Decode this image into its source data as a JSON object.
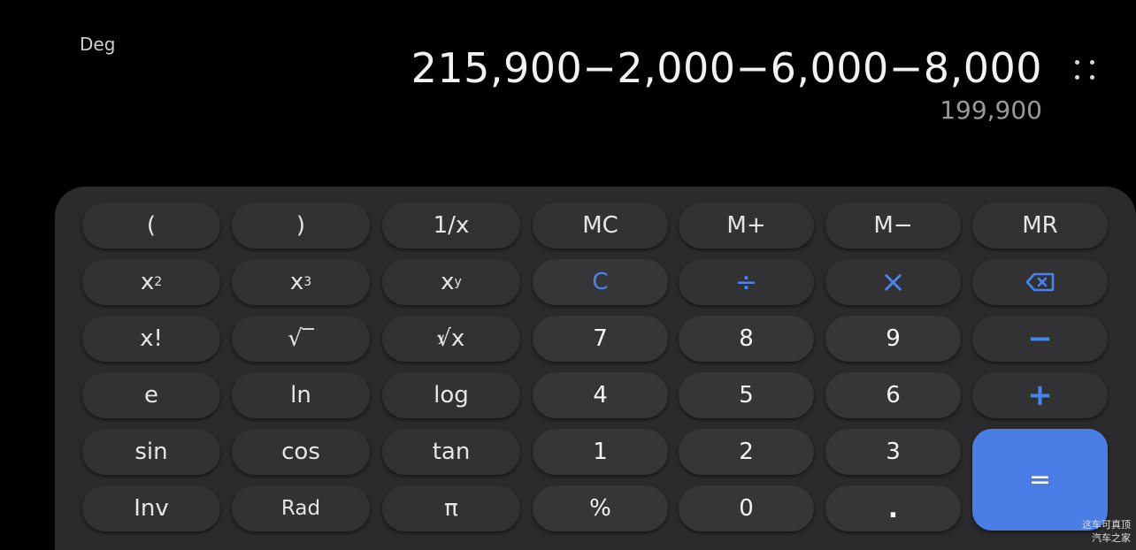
{
  "display": {
    "mode": "Deg",
    "expression": "215,900−2,000−6,000−8,000",
    "result": "199,900"
  },
  "keys": {
    "open_paren": "(",
    "close_paren": ")",
    "reciprocal": "1/x",
    "mc": "MC",
    "m_plus": "M+",
    "m_minus": "M−",
    "mr": "MR",
    "square_base": "x",
    "square_exp": "2",
    "cube_base": "x",
    "cube_exp": "3",
    "power_base": "x",
    "power_exp": "y",
    "clear": "C",
    "divide": "÷",
    "multiply": "×",
    "factorial": "x!",
    "sqrt": "√‾",
    "root_index": "y",
    "root_radical": "√x",
    "seven": "7",
    "eight": "8",
    "nine": "9",
    "minus": "−",
    "e": "e",
    "ln": "ln",
    "log": "log",
    "four": "4",
    "five": "5",
    "six": "6",
    "plus": "+",
    "sin": "sin",
    "cos": "cos",
    "tan": "tan",
    "one": "1",
    "two": "2",
    "three": "3",
    "equals": "=",
    "inv": "Inv",
    "rad": "Rad",
    "pi": "π",
    "percent": "%",
    "zero": "0",
    "decimal": "."
  },
  "icons": {
    "more": "more-dots-icon",
    "backspace": "backspace-icon"
  },
  "colors": {
    "accent": "#4a84f0",
    "equals_bg": "#4a7ee6",
    "panel_bg": "#2b2b2d",
    "key_bg": "#323234"
  },
  "watermark": {
    "line1": "这车可真顶",
    "line2": "汽车之家"
  }
}
